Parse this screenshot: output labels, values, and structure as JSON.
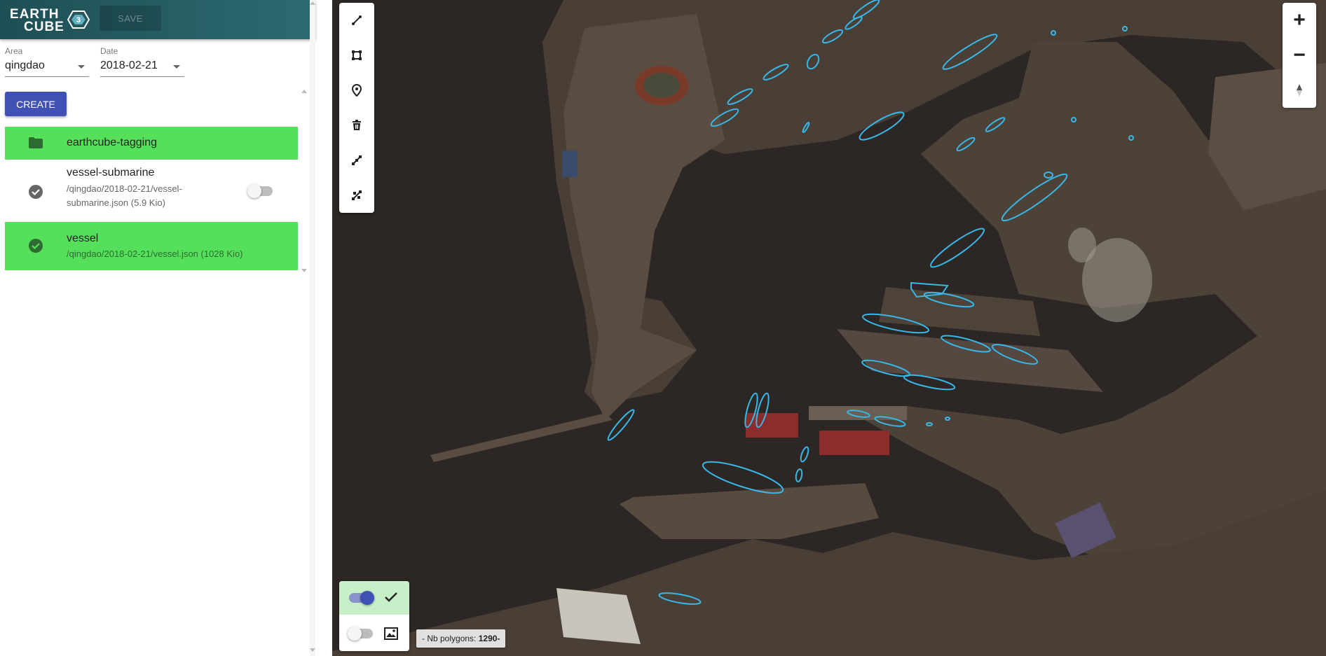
{
  "header": {
    "logo_text_1": "EARTH",
    "logo_text_2": "CUBE",
    "save_label": "SAVE"
  },
  "filters": {
    "area_label": "Area",
    "area_value": "qingdao",
    "date_label": "Date",
    "date_value": "2018-02-21"
  },
  "create_label": "CREATE",
  "layers": [
    {
      "title": "earthcube-tagging",
      "icon": "folder-icon",
      "selected": true
    },
    {
      "title": "vessel-submarine",
      "path_line1": "/qingdao/2018-02-21/vessel-",
      "path_line2": "submarine.json (5.9 Kio)",
      "icon": "check-circle-icon",
      "selected": false,
      "toggle_on": false
    },
    {
      "title": "vessel",
      "path_line1": "/qingdao/2018-02-21/vessel.json (1028 Kio)",
      "icon": "check-circle-icon",
      "selected": true
    }
  ],
  "map": {
    "zoom_in": "+",
    "zoom_out": "−",
    "polygon_count_label": "- Nb polygons: ",
    "polygon_count": "1290",
    "polygon_count_suffix": "-",
    "draw_tools": [
      "line-tool-icon",
      "rectangle-tool-icon",
      "marker-tool-icon",
      "delete-icon",
      "edit-vertices-icon",
      "edit-shape-icon"
    ],
    "vector_layer_on": true,
    "image_layer_on": false
  },
  "colors": {
    "header_bg": "#1e4f55",
    "accent": "#3f51b5",
    "selected_row": "#55e05b",
    "polygon_outline": "#38b8e8"
  }
}
